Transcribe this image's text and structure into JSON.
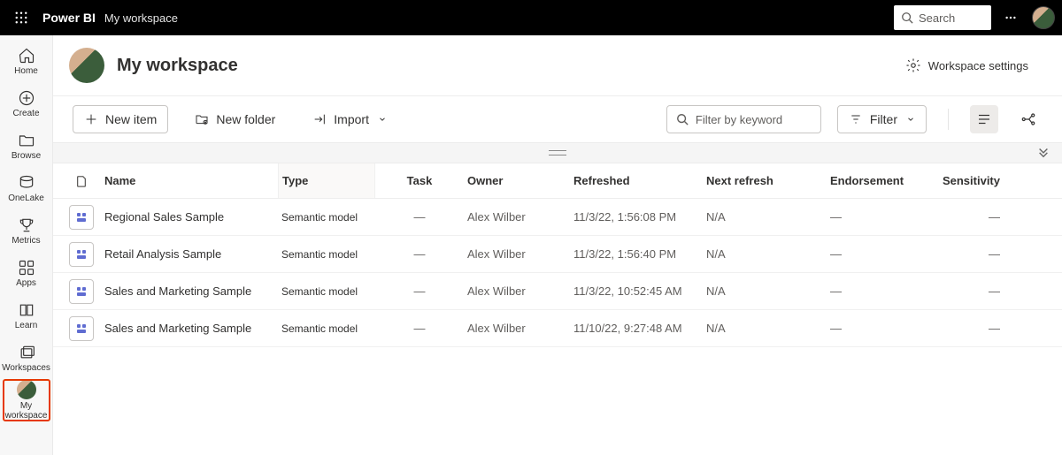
{
  "topbar": {
    "brand": "Power BI",
    "sub": "My workspace",
    "search_placeholder": "Search"
  },
  "nav": {
    "items": [
      {
        "label": "Home"
      },
      {
        "label": "Create"
      },
      {
        "label": "Browse"
      },
      {
        "label": "OneLake"
      },
      {
        "label": "Metrics"
      },
      {
        "label": "Apps"
      },
      {
        "label": "Learn"
      },
      {
        "label": "Workspaces"
      },
      {
        "label": "My workspace"
      }
    ]
  },
  "workspace": {
    "title": "My workspace",
    "settings_label": "Workspace settings"
  },
  "toolbar": {
    "new_item": "New item",
    "new_folder": "New folder",
    "import": "Import",
    "filter_placeholder": "Filter by keyword",
    "filter_label": "Filter"
  },
  "table": {
    "headers": {
      "name": "Name",
      "type": "Type",
      "task": "Task",
      "owner": "Owner",
      "refreshed": "Refreshed",
      "next_refresh": "Next refresh",
      "endorsement": "Endorsement",
      "sensitivity": "Sensitivity"
    },
    "rows": [
      {
        "name": "Regional Sales Sample",
        "type": "Semantic model",
        "task": "—",
        "owner": "Alex Wilber",
        "refreshed": "11/3/22, 1:56:08 PM",
        "next": "N/A",
        "endorsement": "—",
        "sensitivity": "—"
      },
      {
        "name": "Retail Analysis Sample",
        "type": "Semantic model",
        "task": "—",
        "owner": "Alex Wilber",
        "refreshed": "11/3/22, 1:56:40 PM",
        "next": "N/A",
        "endorsement": "—",
        "sensitivity": "—"
      },
      {
        "name": "Sales and Marketing Sample",
        "type": "Semantic model",
        "task": "—",
        "owner": "Alex Wilber",
        "refreshed": "11/3/22, 10:52:45 AM",
        "next": "N/A",
        "endorsement": "—",
        "sensitivity": "—"
      },
      {
        "name": "Sales and Marketing Sample",
        "type": "Semantic model",
        "task": "—",
        "owner": "Alex Wilber",
        "refreshed": "11/10/22, 9:27:48 AM",
        "next": "N/A",
        "endorsement": "—",
        "sensitivity": "—"
      }
    ]
  }
}
